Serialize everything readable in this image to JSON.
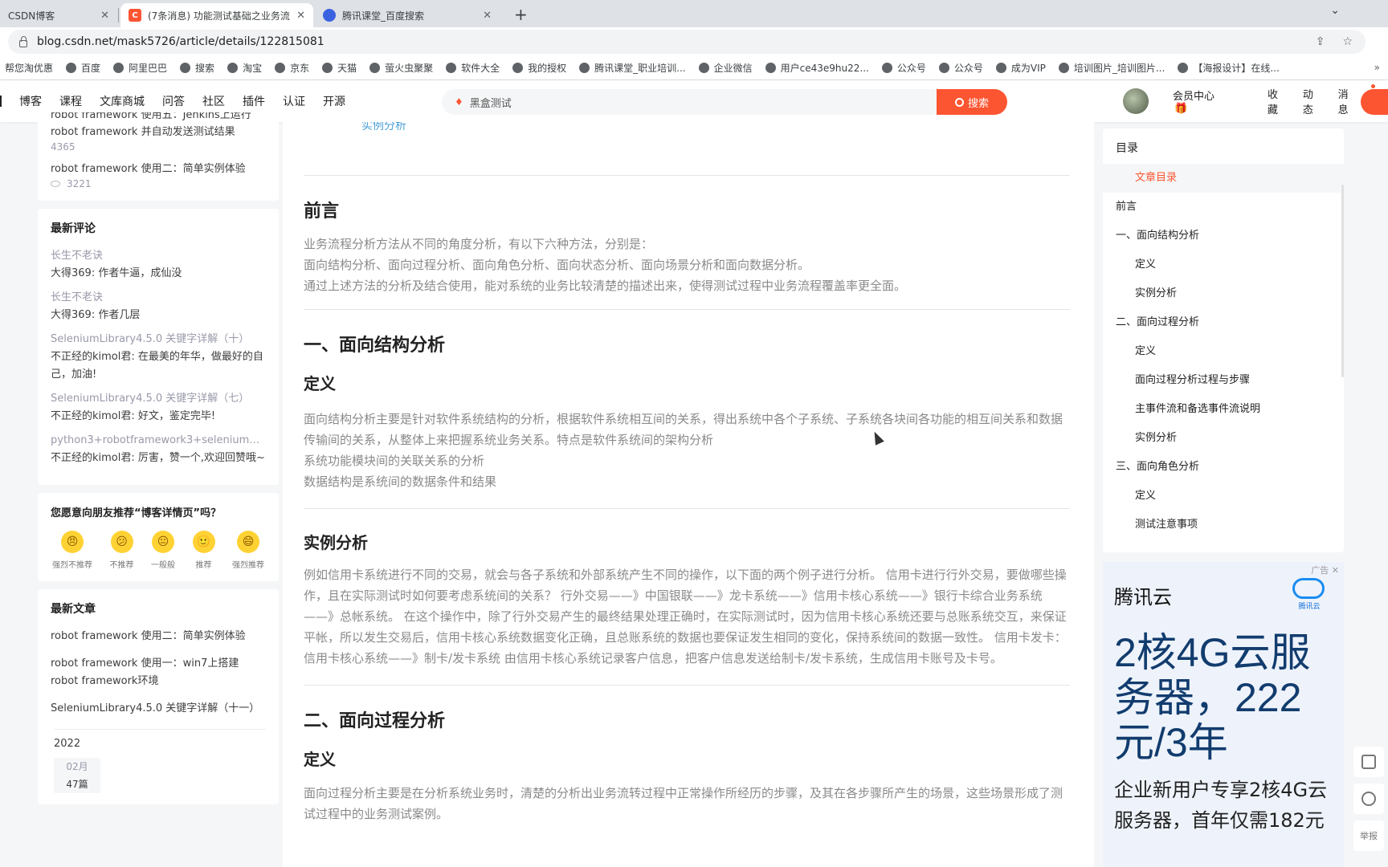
{
  "browser": {
    "tabs": [
      {
        "title": "CSDN博客",
        "active": false
      },
      {
        "title": "(7条消息) 功能测试基础之业务流",
        "active": true
      },
      {
        "title": "腾讯课堂_百度搜索",
        "active": false
      }
    ],
    "url": "blog.csdn.net/mask5726/article/details/122815081",
    "bookmarks": [
      "帮您淘优惠",
      "百度",
      "阿里巴巴",
      "搜索",
      "淘宝",
      "京东",
      "天猫",
      "萤火虫聚聚",
      "软件大全",
      "我的授权",
      "腾讯课堂_职业培训...",
      "企业微信",
      "用户ce43e9hu22...",
      "公众号",
      "公众号",
      "成为VIP",
      "培训图片_培训图片...",
      "【海报设计】在线..."
    ]
  },
  "csdn": {
    "nav": [
      "博客",
      "课程",
      "文库商城",
      "问答",
      "社区",
      "插件",
      "认证",
      "开源"
    ],
    "search_placeholder": "黑盒测试",
    "search_button": "搜索",
    "user_links": {
      "vip": "会员中心",
      "fav": "收藏",
      "dynamic": "动态",
      "msg": "消息"
    }
  },
  "left": {
    "hot": [
      {
        "title": "robot framework 使用五：Jenkins上运行",
        "views": ""
      },
      {
        "title": "robot framework 并自动发送测试结果",
        "views": "4365"
      },
      {
        "title": "robot framework 使用二：简单实例体验",
        "views": "3221"
      }
    ],
    "comments_title": "最新评论",
    "comments": [
      {
        "title": "长生不老诀",
        "body": "大得369: 作者牛逼，成仙没"
      },
      {
        "title": "长生不老诀",
        "body": "大得369: 作者几层"
      },
      {
        "title": "SeleniumLibrary4.5.0 关键字详解（十）",
        "body": "不正经的kimol君: 在最美的年华，做最好的自己，加油!"
      },
      {
        "title": "SeleniumLibrary4.5.0 关键字详解（七）",
        "body": "不正经的kimol君: 好文，鉴定完毕!"
      },
      {
        "title": "python3+robotframework3+selenium3分...",
        "body": "不正经的kimol君: 厉害，赞一个,欢迎回赞哦~"
      }
    ],
    "recommend_title": "您愿意向朋友推荐“博客详情页”吗？",
    "recommend_options": [
      "强烈不推荐",
      "不推荐",
      "一般般",
      "推荐",
      "强烈推荐"
    ],
    "recent_title": "最新文章",
    "recent": [
      "robot framework 使用二：简单实例体验",
      "robot framework 使用一：win7上搭建robot framework环境",
      "SeleniumLibrary4.5.0 关键字详解（十一）"
    ],
    "archive_year": "2022",
    "archive_month": "02月",
    "archive_count": "47篇"
  },
  "article": {
    "top_link": "实例分析",
    "sections": {
      "preface_title": "前言",
      "preface_lines": [
        "业务流程分析方法从不同的角度分析，有以下六种方法，分别是：",
        "面向结构分析、面向过程分析、面向角色分析、面向状态分析、面向场景分析和面向数据分析。",
        "通过上述方法的分析及结合使用，能对系统的业务比较清楚的描述出来，使得测试过程中业务流程覆盖率更全面。"
      ],
      "s1_title": "一、面向结构分析",
      "s1_def": "定义",
      "s1_lines": [
        "面向结构分析主要是针对软件系统结构的分析，根据软件系统相互间的关系，得出系统中各个子系统、子系统各块间各功能的相互间关系和数据传输间的关系，从整体上来把握系统业务关系。特点是软件系统间的架构分析",
        "系统功能模块间的关联关系的分析",
        "数据结构是系统间的数据条件和结果"
      ],
      "s1_example": "实例分析",
      "s1_example_text": "例如信用卡系统进行不同的交易，就会与各子系统和外部系统产生不同的操作，以下面的两个例子进行分析。 信用卡进行行外交易，要做哪些操作，且在实际测试时如何要考虑系统间的关系？ 行外交易——》中国银联——》龙卡系统——》信用卡核心系统——》银行卡综合业务系统——》总帐系统。 在这个操作中，除了行外交易产生的最终结果处理正确时，在实际测试时，因为信用卡核心系统还要与总账系统交互，来保证平帐，所以发生交易后，信用卡核心系统数据变化正确，且总账系统的数据也要保证发生相同的变化，保持系统间的数据一致性。 信用卡发卡：信用卡核心系统——》制卡/发卡系统 由信用卡核心系统记录客户信息，把客户信息发送给制卡/发卡系统，生成信用卡账号及卡号。",
      "s2_title": "二、面向过程分析",
      "s2_def": "定义",
      "s2_text": "面向过程分析主要是在分析系统业务时，清楚的分析出业务流转过程中正常操作所经历的步骤，及其在各步骤所产生的场景，这些场景形成了测试过程中的业务测试案例。"
    }
  },
  "toc": {
    "title": "目录",
    "items": [
      {
        "label": "文章目录",
        "level": 2,
        "active": true
      },
      {
        "label": "前言",
        "level": 1
      },
      {
        "label": "一、面向结构分析",
        "level": 1
      },
      {
        "label": "定义",
        "level": 2
      },
      {
        "label": "实例分析",
        "level": 2
      },
      {
        "label": "二、面向过程分析",
        "level": 1
      },
      {
        "label": "定义",
        "level": 2
      },
      {
        "label": "面向过程分析过程与步骤",
        "level": 2
      },
      {
        "label": "主事件流和备选事件流说明",
        "level": 2
      },
      {
        "label": "实例分析",
        "level": 2
      },
      {
        "label": "三、面向角色分析",
        "level": 1
      },
      {
        "label": "定义",
        "level": 2
      },
      {
        "label": "测试注意事项",
        "level": 2
      }
    ]
  },
  "ad": {
    "tag": "广告",
    "brand": "腾讯云",
    "logo_text": "腾讯云",
    "headline": "2核4G云服务器，222元/3年",
    "sub": "企业新用户专享2核4G云服务器，首年仅需182元"
  },
  "float_tools": {
    "report": "举报"
  }
}
